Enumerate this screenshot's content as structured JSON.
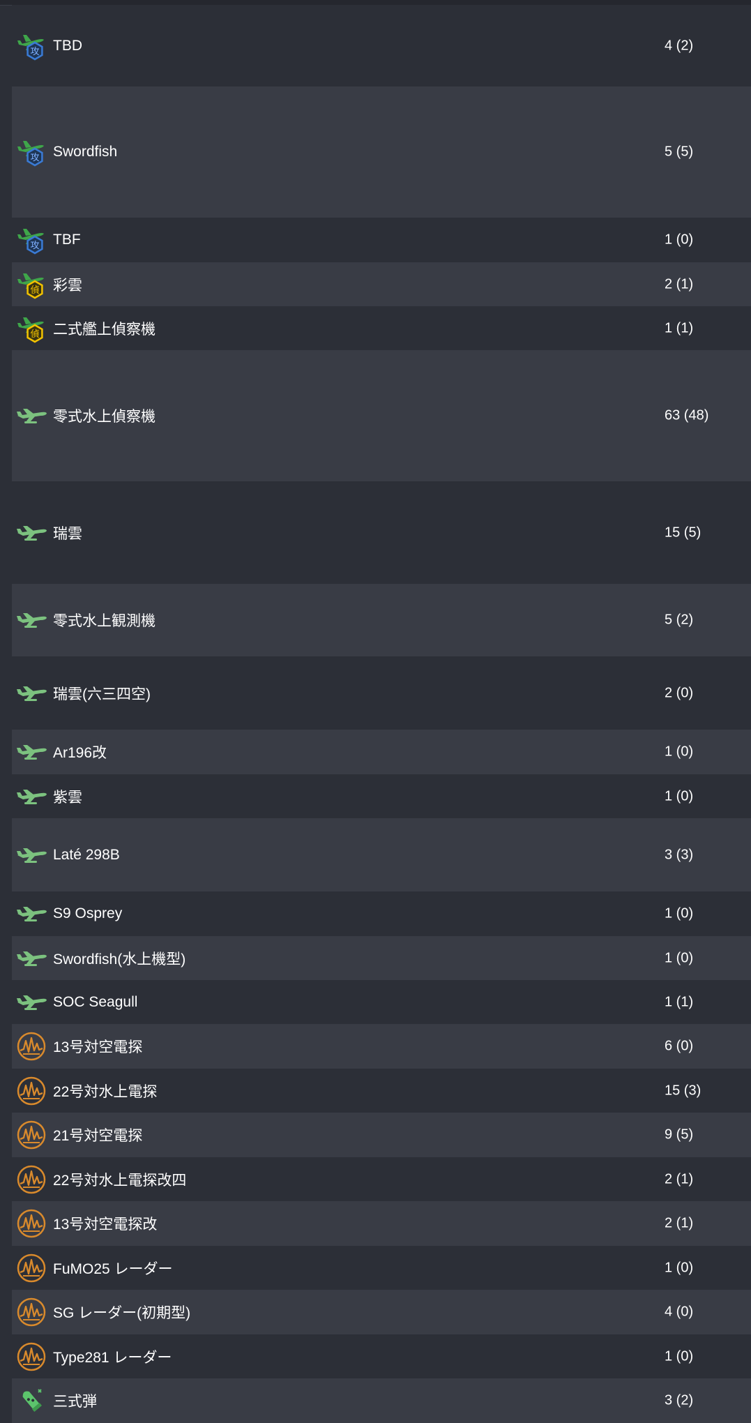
{
  "equipment": [
    {
      "name": "TBD",
      "count": "4 (2)",
      "icon": "torpedo-bomber-icon"
    },
    {
      "name": "Swordfish",
      "count": "5 (5)",
      "icon": "torpedo-bomber-icon"
    },
    {
      "name": "TBF",
      "count": "1 (0)",
      "icon": "torpedo-bomber-icon"
    },
    {
      "name": "彩雲",
      "count": "2 (1)",
      "icon": "recon-plane-icon"
    },
    {
      "name": "二式艦上偵察機",
      "count": "1 (1)",
      "icon": "recon-plane-icon"
    },
    {
      "name": "零式水上偵察機",
      "count": "63 (48)",
      "icon": "seaplane-icon"
    },
    {
      "name": "瑞雲",
      "count": "15 (5)",
      "icon": "seaplane-icon"
    },
    {
      "name": "零式水上観測機",
      "count": "5 (2)",
      "icon": "seaplane-icon"
    },
    {
      "name": "瑞雲(六三四空)",
      "count": "2 (0)",
      "icon": "seaplane-icon"
    },
    {
      "name": "Ar196改",
      "count": "1 (0)",
      "icon": "seaplane-icon"
    },
    {
      "name": "紫雲",
      "count": "1 (0)",
      "icon": "seaplane-icon"
    },
    {
      "name": "Laté 298B",
      "count": "3 (3)",
      "icon": "seaplane-icon"
    },
    {
      "name": "S9 Osprey",
      "count": "1 (0)",
      "icon": "seaplane-icon"
    },
    {
      "name": "Swordfish(水上機型)",
      "count": "1 (0)",
      "icon": "seaplane-icon"
    },
    {
      "name": "SOC Seagull",
      "count": "1 (1)",
      "icon": "seaplane-icon"
    },
    {
      "name": "13号対空電探",
      "count": "6 (0)",
      "icon": "radar-icon"
    },
    {
      "name": "22号対水上電探",
      "count": "15 (3)",
      "icon": "radar-icon"
    },
    {
      "name": "21号対空電探",
      "count": "9 (5)",
      "icon": "radar-icon"
    },
    {
      "name": "22号対水上電探改四",
      "count": "2 (1)",
      "icon": "radar-icon"
    },
    {
      "name": "13号対空電探改",
      "count": "2 (1)",
      "icon": "radar-icon"
    },
    {
      "name": "FuMO25 レーダー",
      "count": "1 (0)",
      "icon": "radar-icon"
    },
    {
      "name": "SG レーダー(初期型)",
      "count": "4 (0)",
      "icon": "radar-icon"
    },
    {
      "name": "Type281 レーダー",
      "count": "1 (0)",
      "icon": "radar-icon"
    },
    {
      "name": "三式弾",
      "count": "3 (2)",
      "icon": "aa-shell-icon"
    }
  ],
  "icon_badges": {
    "torpedo-bomber-icon": "攻",
    "recon-plane-icon": "偵"
  },
  "colors": {
    "row_dark": "#2c2f37",
    "row_light": "#393c45",
    "plane_green": "#3fa64a",
    "seaplane_green": "#7cc27f",
    "attack_blue": "#3a7bd5",
    "recon_yellow": "#f2c200",
    "radar_orange": "#d98a2c"
  }
}
